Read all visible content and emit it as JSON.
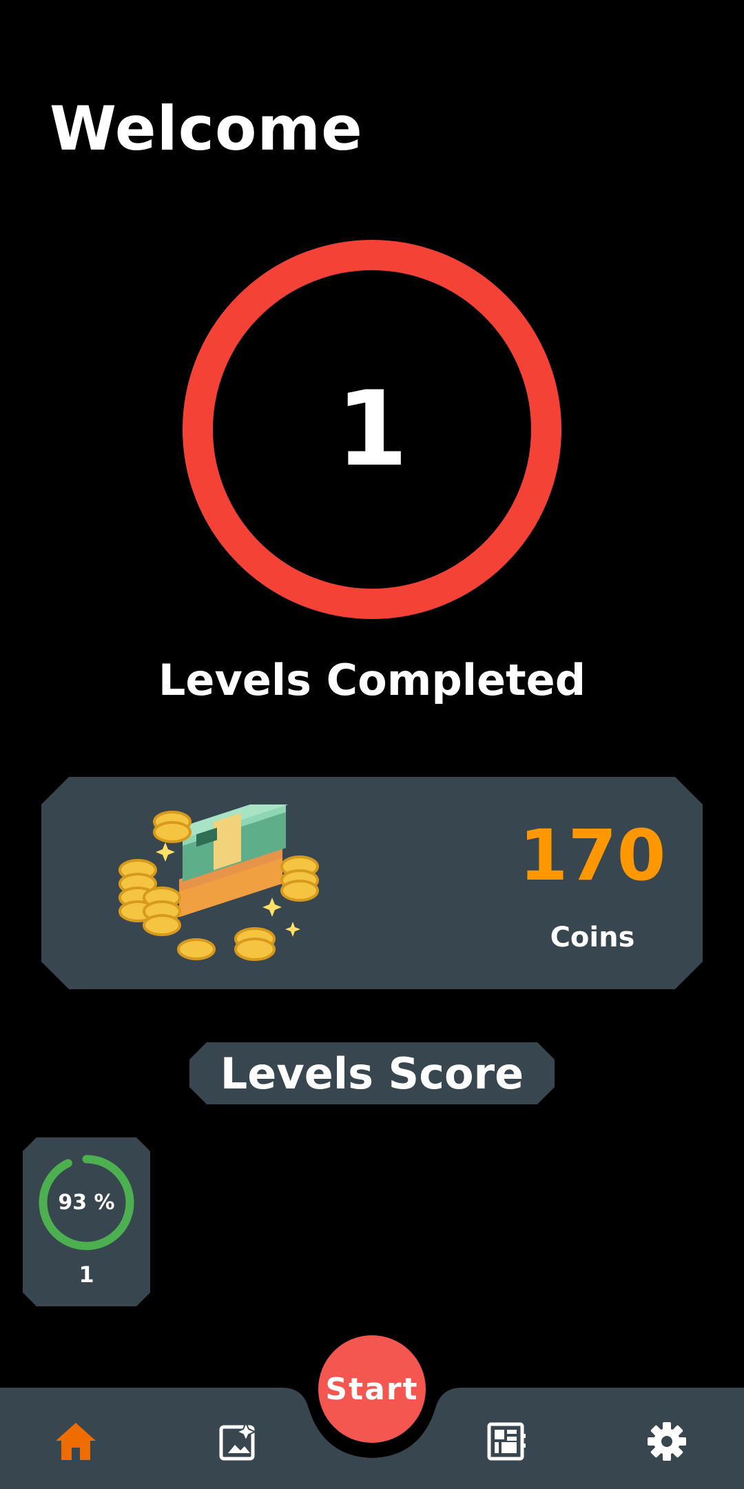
{
  "header": {
    "title": "Welcome"
  },
  "progress": {
    "levels_completed_value": "1",
    "levels_completed_label": "Levels Completed",
    "ring_color": "#f44336"
  },
  "coins": {
    "value": "170",
    "label": "Coins",
    "value_color": "#ff9800",
    "illustration": "coins-and-cash-icon"
  },
  "levels_score": {
    "title": "Levels Score",
    "levels": [
      {
        "level": "1",
        "percent_label": "93 %",
        "percent": 0.93,
        "ring_color": "#4caf50"
      }
    ]
  },
  "bottom_nav": {
    "start_label": "Start",
    "start_color": "#f4574f",
    "active_color": "#ef6c00",
    "items": [
      {
        "icon": "home-icon",
        "active": true
      },
      {
        "icon": "sparkle-image-icon",
        "active": false
      },
      {
        "icon": "grid-board-icon",
        "active": false
      },
      {
        "icon": "gear-icon",
        "active": false
      }
    ]
  }
}
